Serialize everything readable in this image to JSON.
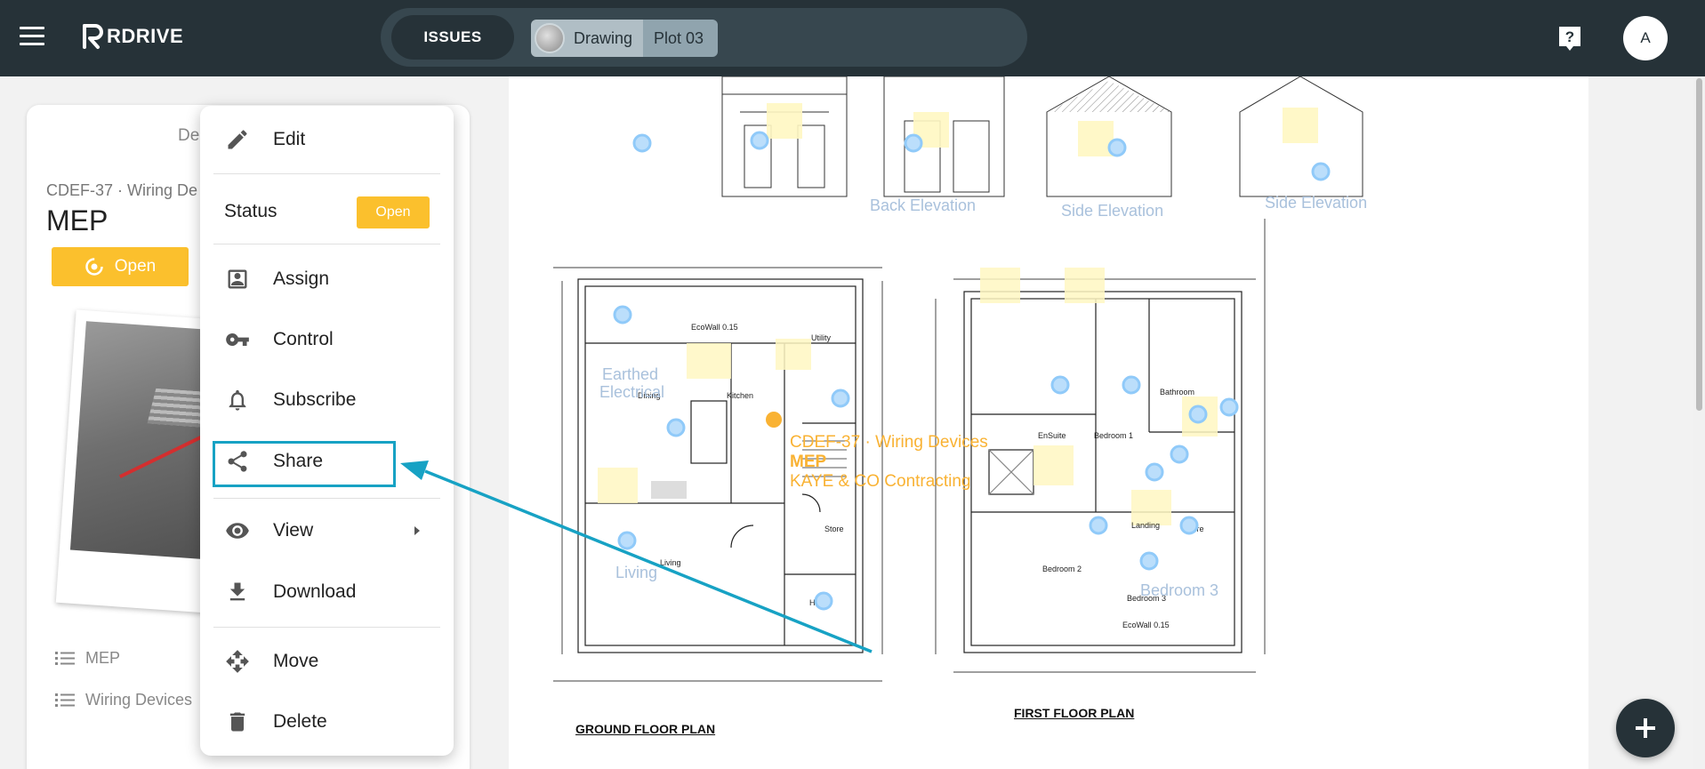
{
  "topbar": {
    "brand": "RDRIVE",
    "issues_label": "ISSUES",
    "crumb_drawing": "Drawing",
    "crumb_plot": "Plot 03",
    "avatar_initial": "A"
  },
  "panel": {
    "tab_label": "De",
    "issue_code": "CDEF-37 · Wiring De",
    "issue_title": "MEP",
    "status_label": "Open",
    "tags": [
      "MEP",
      "Wiring Devices"
    ]
  },
  "menu": {
    "edit": "Edit",
    "status_label": "Status",
    "status_value": "Open",
    "assign": "Assign",
    "control": "Control",
    "subscribe": "Subscribe",
    "share": "Share",
    "view": "View",
    "download": "Download",
    "move": "Move",
    "delete": "Delete"
  },
  "drawing": {
    "ground_floor_label": "GROUND FLOOR PLAN",
    "first_floor_label": "FIRST FLOOR PLAN",
    "elevations": [
      "Back Elevation",
      "Side Elevation",
      "Side Elevation"
    ],
    "pin_labels": {
      "earthed": "Earthed",
      "earthed2": "Electrical",
      "living": "Living",
      "bedroom3": "Bedroom 3"
    },
    "selected_issue": {
      "line1": "CDEF-37 · Wiring Devices",
      "line2": "MEP",
      "line3": "KAYE & CO Contracting"
    },
    "rooms_ground": {
      "dining": "Dining",
      "kitchen": "Kitchen",
      "living": "Living",
      "store": "Store",
      "hall": "Hall",
      "utility": "Utility",
      "ecowall": "EcoWall 0.15"
    },
    "rooms_first": {
      "ensuite": "EnSuite",
      "bedroom1": "Bedroom 1",
      "bedroom2": "Bedroom 2",
      "bedroom3": "Bedroom 3",
      "bathroom": "Bathroom",
      "landing": "Landing",
      "store": "Store",
      "ecowall": "EcoWall 0.15"
    }
  },
  "colors": {
    "topbar": "#263238",
    "accent_status": "#fbc02d",
    "annotation": "#17a2c4",
    "pin": "#90caf9"
  }
}
